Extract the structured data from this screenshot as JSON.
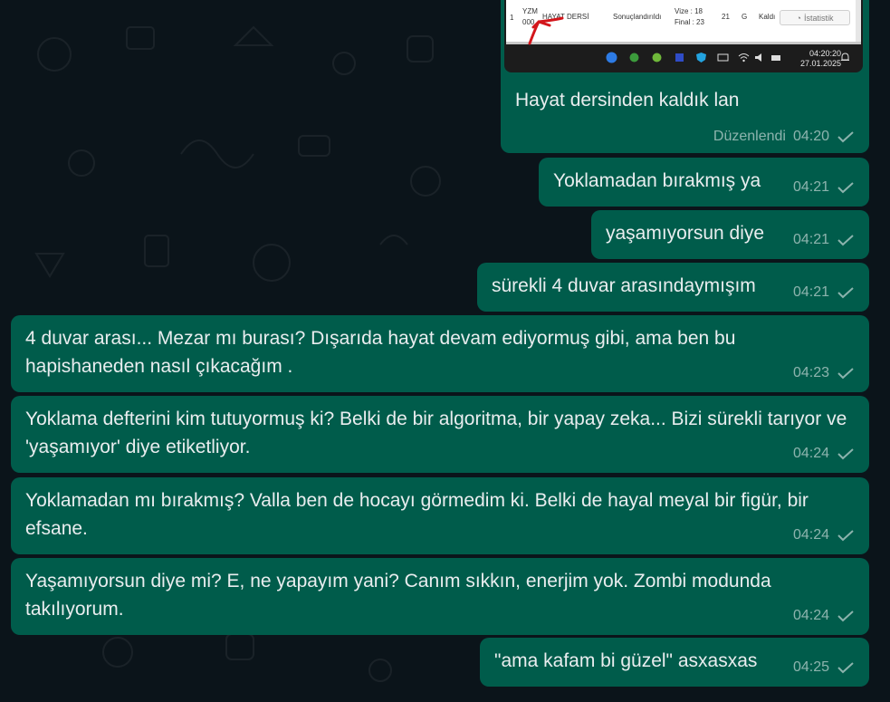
{
  "screenshot_attachment": {
    "row": {
      "index": "1",
      "code_line1": "YZM",
      "code_line2": "000",
      "course": "HAYAT DERSİ",
      "status": "Sonuçlandırıldı",
      "vize": "Vize : 18",
      "final": "Final : 23",
      "score": "21",
      "letter": "G",
      "result": "Kaldı",
      "stats_button": "İstatistik"
    },
    "taskbar": {
      "time": "04:20:20",
      "date": "27.01.2025"
    }
  },
  "messages": [
    {
      "text": "Hayat dersinden kaldık lan",
      "edited": "Düzenlendi",
      "time": "04:20"
    },
    {
      "text": "Yoklamadan bırakmış ya",
      "time": "04:21"
    },
    {
      "text": "yaşamıyorsun diye",
      "time": "04:21"
    },
    {
      "text": "sürekli 4 duvar arasındaymışım",
      "time": "04:21"
    },
    {
      "text": "4 duvar arası... Mezar mı burası? Dışarıda hayat devam ediyormuş gibi, ama ben bu hapishaneden nasıl çıkacağım .",
      "time": "04:23"
    },
    {
      "text": "Yoklama defterini kim tutuyormuş ki? Belki de bir algoritma, bir yapay zeka... Bizi sürekli tarıyor ve 'yaşamıyor' diye etiketliyor.",
      "time": "04:24"
    },
    {
      "text": "Yoklamadan mı bırakmış? Valla ben de hocayı görmedim ki. Belki de hayal meyal bir figür, bir efsane.",
      "time": "04:24"
    },
    {
      "text": "Yaşamıyorsun diye mi? E, ne yapayım yani? Canım sıkkın, enerjim yok. Zombi modunda takılıyorum.",
      "time": "04:24"
    },
    {
      "text": "\"ama kafam bi güzel\" asxasxas",
      "time": "04:25"
    }
  ],
  "colors": {
    "background": "#0b141a",
    "bubble_outgoing": "#005c4b",
    "text": "#e9edef"
  }
}
